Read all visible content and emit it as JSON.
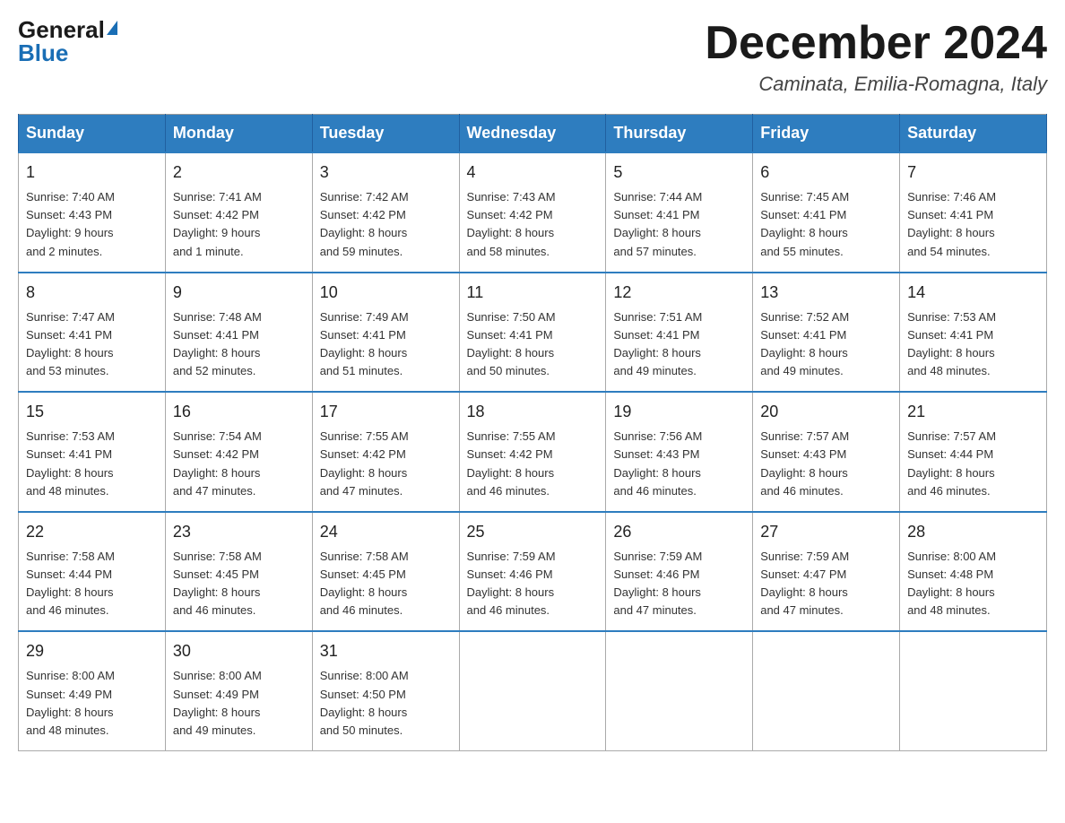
{
  "logo": {
    "general": "General",
    "blue": "Blue",
    "triangle": "▶"
  },
  "header": {
    "month_title": "December 2024",
    "location": "Caminata, Emilia-Romagna, Italy"
  },
  "weekdays": [
    "Sunday",
    "Monday",
    "Tuesday",
    "Wednesday",
    "Thursday",
    "Friday",
    "Saturday"
  ],
  "weeks": [
    {
      "days": [
        {
          "date": "1",
          "sunrise": "7:40 AM",
          "sunset": "4:43 PM",
          "daylight": "9 hours and 2 minutes."
        },
        {
          "date": "2",
          "sunrise": "7:41 AM",
          "sunset": "4:42 PM",
          "daylight": "9 hours and 1 minute."
        },
        {
          "date": "3",
          "sunrise": "7:42 AM",
          "sunset": "4:42 PM",
          "daylight": "8 hours and 59 minutes."
        },
        {
          "date": "4",
          "sunrise": "7:43 AM",
          "sunset": "4:42 PM",
          "daylight": "8 hours and 58 minutes."
        },
        {
          "date": "5",
          "sunrise": "7:44 AM",
          "sunset": "4:41 PM",
          "daylight": "8 hours and 57 minutes."
        },
        {
          "date": "6",
          "sunrise": "7:45 AM",
          "sunset": "4:41 PM",
          "daylight": "8 hours and 55 minutes."
        },
        {
          "date": "7",
          "sunrise": "7:46 AM",
          "sunset": "4:41 PM",
          "daylight": "8 hours and 54 minutes."
        }
      ]
    },
    {
      "days": [
        {
          "date": "8",
          "sunrise": "7:47 AM",
          "sunset": "4:41 PM",
          "daylight": "8 hours and 53 minutes."
        },
        {
          "date": "9",
          "sunrise": "7:48 AM",
          "sunset": "4:41 PM",
          "daylight": "8 hours and 52 minutes."
        },
        {
          "date": "10",
          "sunrise": "7:49 AM",
          "sunset": "4:41 PM",
          "daylight": "8 hours and 51 minutes."
        },
        {
          "date": "11",
          "sunrise": "7:50 AM",
          "sunset": "4:41 PM",
          "daylight": "8 hours and 50 minutes."
        },
        {
          "date": "12",
          "sunrise": "7:51 AM",
          "sunset": "4:41 PM",
          "daylight": "8 hours and 49 minutes."
        },
        {
          "date": "13",
          "sunrise": "7:52 AM",
          "sunset": "4:41 PM",
          "daylight": "8 hours and 49 minutes."
        },
        {
          "date": "14",
          "sunrise": "7:53 AM",
          "sunset": "4:41 PM",
          "daylight": "8 hours and 48 minutes."
        }
      ]
    },
    {
      "days": [
        {
          "date": "15",
          "sunrise": "7:53 AM",
          "sunset": "4:41 PM",
          "daylight": "8 hours and 48 minutes."
        },
        {
          "date": "16",
          "sunrise": "7:54 AM",
          "sunset": "4:42 PM",
          "daylight": "8 hours and 47 minutes."
        },
        {
          "date": "17",
          "sunrise": "7:55 AM",
          "sunset": "4:42 PM",
          "daylight": "8 hours and 47 minutes."
        },
        {
          "date": "18",
          "sunrise": "7:55 AM",
          "sunset": "4:42 PM",
          "daylight": "8 hours and 46 minutes."
        },
        {
          "date": "19",
          "sunrise": "7:56 AM",
          "sunset": "4:43 PM",
          "daylight": "8 hours and 46 minutes."
        },
        {
          "date": "20",
          "sunrise": "7:57 AM",
          "sunset": "4:43 PM",
          "daylight": "8 hours and 46 minutes."
        },
        {
          "date": "21",
          "sunrise": "7:57 AM",
          "sunset": "4:44 PM",
          "daylight": "8 hours and 46 minutes."
        }
      ]
    },
    {
      "days": [
        {
          "date": "22",
          "sunrise": "7:58 AM",
          "sunset": "4:44 PM",
          "daylight": "8 hours and 46 minutes."
        },
        {
          "date": "23",
          "sunrise": "7:58 AM",
          "sunset": "4:45 PM",
          "daylight": "8 hours and 46 minutes."
        },
        {
          "date": "24",
          "sunrise": "7:58 AM",
          "sunset": "4:45 PM",
          "daylight": "8 hours and 46 minutes."
        },
        {
          "date": "25",
          "sunrise": "7:59 AM",
          "sunset": "4:46 PM",
          "daylight": "8 hours and 46 minutes."
        },
        {
          "date": "26",
          "sunrise": "7:59 AM",
          "sunset": "4:46 PM",
          "daylight": "8 hours and 47 minutes."
        },
        {
          "date": "27",
          "sunrise": "7:59 AM",
          "sunset": "4:47 PM",
          "daylight": "8 hours and 47 minutes."
        },
        {
          "date": "28",
          "sunrise": "8:00 AM",
          "sunset": "4:48 PM",
          "daylight": "8 hours and 48 minutes."
        }
      ]
    },
    {
      "days": [
        {
          "date": "29",
          "sunrise": "8:00 AM",
          "sunset": "4:49 PM",
          "daylight": "8 hours and 48 minutes."
        },
        {
          "date": "30",
          "sunrise": "8:00 AM",
          "sunset": "4:49 PM",
          "daylight": "8 hours and 49 minutes."
        },
        {
          "date": "31",
          "sunrise": "8:00 AM",
          "sunset": "4:50 PM",
          "daylight": "8 hours and 50 minutes."
        },
        null,
        null,
        null,
        null
      ]
    }
  ],
  "labels": {
    "sunrise": "Sunrise:",
    "sunset": "Sunset:",
    "daylight": "Daylight:"
  }
}
